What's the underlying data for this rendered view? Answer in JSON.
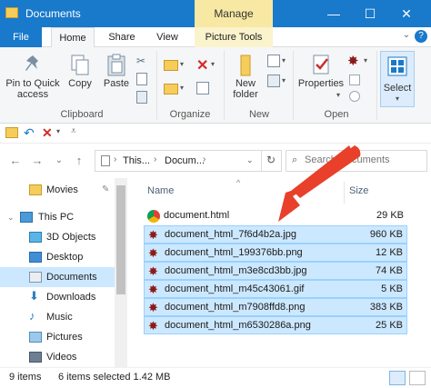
{
  "window": {
    "title": "Documents",
    "context_tab": "Manage",
    "minimize": "—",
    "maximize": "☐",
    "close": "✕"
  },
  "ribbon_tabs": [
    "File",
    "Home",
    "Share",
    "View",
    "Picture Tools"
  ],
  "ribbon": {
    "clipboard": {
      "pin_label": "Pin to Quick access",
      "pin_line1": "Pin to Quick",
      "pin_line2": "access",
      "copy_label": "Copy",
      "paste_label": "Paste",
      "group_label": "Clipboard"
    },
    "organize": {
      "group_label": "Organize"
    },
    "new": {
      "new_folder_line1": "New",
      "new_folder_line2": "folder",
      "group_label": "New"
    },
    "open": {
      "properties_label": "Properties",
      "group_label": "Open"
    },
    "select": {
      "select_label": "Select"
    }
  },
  "navigation": {
    "back": "←",
    "forward": "→",
    "recent": "⌄",
    "up": "↑",
    "refresh": "↻",
    "breadcrumbs": [
      "This...",
      "Docum..."
    ],
    "search_placeholder": "Search Documents"
  },
  "nav_pane": [
    {
      "label": "Movies",
      "icon": "folder-icon",
      "selected": false
    },
    {
      "label": "This PC",
      "icon": "pc-icon",
      "selected": false
    },
    {
      "label": "3D Objects",
      "icon": "3d-objects-icon",
      "selected": false
    },
    {
      "label": "Desktop",
      "icon": "desktop-icon",
      "selected": false
    },
    {
      "label": "Documents",
      "icon": "documents-icon",
      "selected": true
    },
    {
      "label": "Downloads",
      "icon": "downloads-icon",
      "selected": false
    },
    {
      "label": "Music",
      "icon": "music-icon",
      "selected": false
    },
    {
      "label": "Pictures",
      "icon": "pictures-icon",
      "selected": false
    },
    {
      "label": "Videos",
      "icon": "videos-icon",
      "selected": false
    }
  ],
  "file_list": {
    "columns": {
      "name": "Name",
      "size": "Size"
    },
    "rows": [
      {
        "name": "document.html",
        "size": "29 KB",
        "selected": false,
        "icon": "chrome-icon"
      },
      {
        "name": "document_html_7f6d4b2a.jpg",
        "size": "960 KB",
        "selected": true,
        "icon": "image-icon"
      },
      {
        "name": "document_html_199376bb.png",
        "size": "12 KB",
        "selected": true,
        "icon": "image-icon"
      },
      {
        "name": "document_html_m3e8cd3bb.jpg",
        "size": "74 KB",
        "selected": true,
        "icon": "image-icon"
      },
      {
        "name": "document_html_m45c43061.gif",
        "size": "5 KB",
        "selected": true,
        "icon": "image-icon"
      },
      {
        "name": "document_html_m7908ffd8.png",
        "size": "383 KB",
        "selected": true,
        "icon": "image-icon"
      },
      {
        "name": "document_html_m6530286a.png",
        "size": "25 KB",
        "selected": true,
        "icon": "image-icon"
      }
    ]
  },
  "status_bar": {
    "item_count": "9 items",
    "selection": "6 items selected  1.42 MB"
  },
  "colors": {
    "titlebar": "#1979ca",
    "context_tab": "#f7e9a4",
    "selection": "#cce8ff",
    "arrow": "#e8402a"
  }
}
